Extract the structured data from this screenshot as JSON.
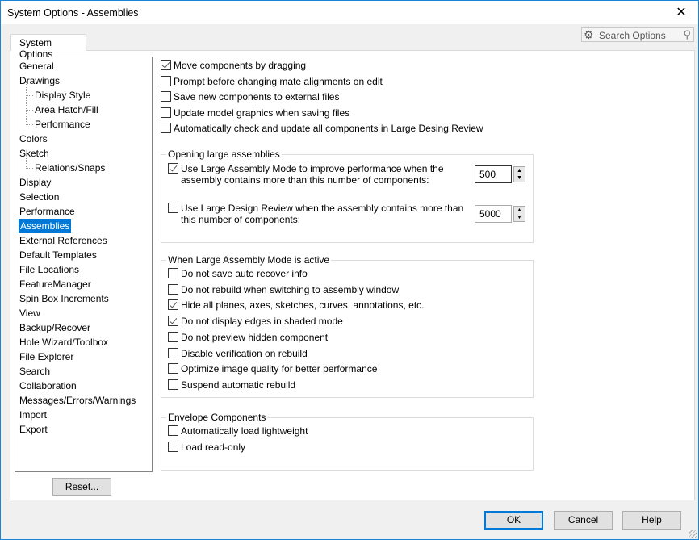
{
  "window": {
    "title": "System Options - Assemblies",
    "close": "✕"
  },
  "tab": "System Options",
  "search": {
    "placeholder": "Search Options",
    "icon": "search-icon",
    "gear": "gear-icon"
  },
  "tree": [
    {
      "label": "General",
      "sub": false
    },
    {
      "label": "Drawings",
      "sub": false
    },
    {
      "label": "Display Style",
      "sub": true
    },
    {
      "label": "Area Hatch/Fill",
      "sub": true
    },
    {
      "label": "Performance",
      "sub": true
    },
    {
      "label": "Colors",
      "sub": false
    },
    {
      "label": "Sketch",
      "sub": false
    },
    {
      "label": "Relations/Snaps",
      "sub": true
    },
    {
      "label": "Display",
      "sub": false
    },
    {
      "label": "Selection",
      "sub": false
    },
    {
      "label": "Performance",
      "sub": false
    },
    {
      "label": "Assemblies",
      "sub": false,
      "selected": true
    },
    {
      "label": "External References",
      "sub": false
    },
    {
      "label": "Default Templates",
      "sub": false
    },
    {
      "label": "File Locations",
      "sub": false
    },
    {
      "label": "FeatureManager",
      "sub": false
    },
    {
      "label": "Spin Box Increments",
      "sub": false
    },
    {
      "label": "View",
      "sub": false
    },
    {
      "label": "Backup/Recover",
      "sub": false
    },
    {
      "label": "Hole Wizard/Toolbox",
      "sub": false
    },
    {
      "label": "File Explorer",
      "sub": false
    },
    {
      "label": "Search",
      "sub": false
    },
    {
      "label": "Collaboration",
      "sub": false
    },
    {
      "label": "Messages/Errors/Warnings",
      "sub": false
    },
    {
      "label": "Import",
      "sub": false
    },
    {
      "label": "Export",
      "sub": false
    }
  ],
  "top_options": [
    {
      "label": "Move components by dragging",
      "checked": true
    },
    {
      "label": "Prompt before changing mate alignments on edit",
      "checked": false
    },
    {
      "label": "Save new components to external files",
      "checked": false
    },
    {
      "label": "Update model graphics when saving files",
      "checked": false
    },
    {
      "label": "Automatically check and update all components in Large Desing Review",
      "checked": false
    }
  ],
  "opening": {
    "title": "Opening large assemblies",
    "lam": {
      "line1": "Use Large Assembly Mode to improve performance when the",
      "line2": "assembly contains more than this number of components:",
      "checked": true,
      "value": "500"
    },
    "ldr": {
      "line1": "Use Large Design Review when the assembly contains more than",
      "line2": "this number of components:",
      "checked": false,
      "value": "5000"
    }
  },
  "lam_active": {
    "title": "When Large Assembly Mode is active",
    "items": [
      {
        "label": "Do not save auto recover info",
        "checked": false
      },
      {
        "label": "Do not rebuild when switching to assembly window",
        "checked": false
      },
      {
        "label": "Hide all planes, axes, sketches, curves, annotations, etc.",
        "checked": true
      },
      {
        "label": "Do not display edges in shaded mode",
        "checked": true
      },
      {
        "label": "Do not preview hidden component",
        "checked": false
      },
      {
        "label": "Disable verification on rebuild",
        "checked": false
      },
      {
        "label": "Optimize image quality for better performance",
        "checked": false
      },
      {
        "label": "Suspend automatic rebuild",
        "checked": false
      }
    ]
  },
  "envelope": {
    "title": "Envelope Components",
    "items": [
      {
        "label": "Automatically load lightweight",
        "checked": false
      },
      {
        "label": "Load read-only",
        "checked": false
      }
    ]
  },
  "buttons": {
    "reset": "Reset...",
    "ok": "OK",
    "cancel": "Cancel",
    "help": "Help"
  }
}
